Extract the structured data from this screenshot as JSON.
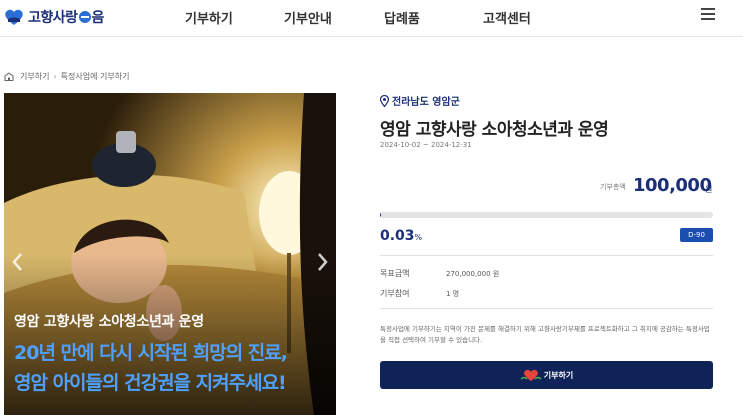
{
  "header": {
    "logo_text_part1": "고향사랑",
    "logo_text_part2": "음",
    "nav": [
      "기부하기",
      "기부안내",
      "답례품",
      "고객센터"
    ]
  },
  "breadcrumb": {
    "items": [
      "기부하기",
      "특정사업에 기부하기"
    ]
  },
  "hero": {
    "subtitle": "영암 고향사랑 소아청소년과 운영",
    "headline_line1": "20년 만에 다시 시작된 희망의 진료,",
    "headline_line2": "영암 아이들의 건강권을 지켜주세요!"
  },
  "project": {
    "region": "전라남도 영암군",
    "title": "영암 고향사랑 소아청소년과 운영",
    "period": "2024-10-02 ~ 2024-12-31",
    "total_label": "기부총액",
    "total_amount": "100,000",
    "total_unit": "원",
    "progress_fraction": 0.0003,
    "percent_value": "0.03",
    "percent_unit": "%",
    "dday": "D-90",
    "goal_label": "목표금액",
    "goal_value": "270,000,000 원",
    "participants_label": "기부참여",
    "participants_value": "1 명",
    "notice": "특정사업에 기부하기는 지역이 가진 문제를 해결하기 위해 고향사랑기부제를 프로젝트화하고 그 취지에 공감하는 특정사업을 직접 선택하여 기부할 수 있습니다.",
    "donate_label": "기부하기"
  },
  "colors": {
    "brand_navy": "#1a2f78",
    "button_navy": "#0f2358",
    "hero_headline": "#4ea1ff",
    "dday_bg": "#1a4fb0"
  },
  "icons": [
    "logo-heart-icon",
    "menu-icon",
    "home-icon",
    "location-pin-icon",
    "chevron-left-icon",
    "chevron-right-icon",
    "heart-hands-icon"
  ]
}
